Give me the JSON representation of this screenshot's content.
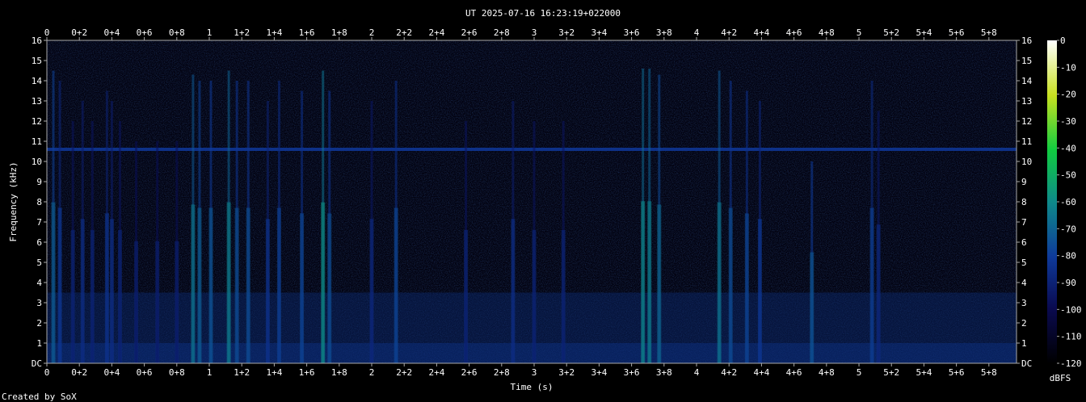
{
  "chart_data": {
    "type": "heatmap",
    "title": "UT 2025-07-16 16:23:19+022000",
    "xlabel": "Time (s)",
    "ylabel": "Frequency (kHz)",
    "xlim": [
      0,
      5.97
    ],
    "ylim": [
      0,
      16
    ],
    "x_ticks": [
      "0",
      "0+2",
      "0+4",
      "0+6",
      "0+8",
      "1",
      "1+2",
      "1+4",
      "1+6",
      "1+8",
      "2",
      "2+2",
      "2+4",
      "2+6",
      "2+8",
      "3",
      "3+2",
      "3+4",
      "3+6",
      "3+8",
      "4",
      "4+2",
      "4+4",
      "4+6",
      "4+8",
      "5",
      "5+2",
      "5+4",
      "5+6",
      "5+8"
    ],
    "x_tick_values": [
      0,
      0.2,
      0.4,
      0.6,
      0.8,
      1,
      1.2,
      1.4,
      1.6,
      1.8,
      2,
      2.2,
      2.4,
      2.6,
      2.8,
      3,
      3.2,
      3.4,
      3.6,
      3.8,
      4,
      4.2,
      4.4,
      4.6,
      4.8,
      5,
      5.2,
      5.4,
      5.6,
      5.8
    ],
    "y_ticks": [
      "DC",
      "1",
      "2",
      "3",
      "4",
      "5",
      "6",
      "7",
      "8",
      "9",
      "10",
      "11",
      "12",
      "13",
      "14",
      "15",
      "16"
    ],
    "y_tick_values": [
      0,
      1,
      2,
      3,
      4,
      5,
      6,
      7,
      8,
      9,
      10,
      11,
      12,
      13,
      14,
      15,
      16
    ],
    "colorbar": {
      "label": "dBFS",
      "ticks": [
        "0",
        "-10",
        "-20",
        "-30",
        "-40",
        "-50",
        "-60",
        "-70",
        "-80",
        "-90",
        "-100",
        "-110",
        "-120"
      ],
      "tick_values": [
        0,
        -10,
        -20,
        -30,
        -40,
        -50,
        -60,
        -70,
        -80,
        -90,
        -100,
        -110,
        -120
      ],
      "range": [
        -120,
        0
      ]
    },
    "horizontal_tone_khz": 10.6,
    "bursts": [
      {
        "t": 0.04,
        "fmax": 14.5,
        "level": -78
      },
      {
        "t": 0.08,
        "fmax": 14.0,
        "level": -88
      },
      {
        "t": 0.16,
        "fmax": 12.0,
        "level": -96
      },
      {
        "t": 0.22,
        "fmax": 13.0,
        "level": -92
      },
      {
        "t": 0.28,
        "fmax": 12.0,
        "level": -96
      },
      {
        "t": 0.37,
        "fmax": 13.5,
        "level": -90
      },
      {
        "t": 0.4,
        "fmax": 13.0,
        "level": -92
      },
      {
        "t": 0.45,
        "fmax": 12.0,
        "level": -96
      },
      {
        "t": 0.55,
        "fmax": 11.0,
        "level": -98
      },
      {
        "t": 0.68,
        "fmax": 11.0,
        "level": -98
      },
      {
        "t": 0.8,
        "fmax": 11.0,
        "level": -98
      },
      {
        "t": 0.9,
        "fmax": 14.3,
        "level": -72
      },
      {
        "t": 0.94,
        "fmax": 14.0,
        "level": -78
      },
      {
        "t": 1.01,
        "fmax": 14.0,
        "level": -80
      },
      {
        "t": 1.12,
        "fmax": 14.5,
        "level": -70
      },
      {
        "t": 1.17,
        "fmax": 14.0,
        "level": -82
      },
      {
        "t": 1.24,
        "fmax": 14.0,
        "level": -82
      },
      {
        "t": 1.36,
        "fmax": 13.0,
        "level": -90
      },
      {
        "t": 1.43,
        "fmax": 14.0,
        "level": -86
      },
      {
        "t": 1.57,
        "fmax": 13.5,
        "level": -84
      },
      {
        "t": 1.7,
        "fmax": 14.5,
        "level": -66
      },
      {
        "t": 1.74,
        "fmax": 13.5,
        "level": -82
      },
      {
        "t": 2.0,
        "fmax": 13.0,
        "level": -94
      },
      {
        "t": 2.15,
        "fmax": 14.0,
        "level": -84
      },
      {
        "t": 2.58,
        "fmax": 12.0,
        "level": -96
      },
      {
        "t": 2.87,
        "fmax": 13.0,
        "level": -92
      },
      {
        "t": 3.0,
        "fmax": 12.0,
        "level": -96
      },
      {
        "t": 3.18,
        "fmax": 12.0,
        "level": -96
      },
      {
        "t": 3.67,
        "fmax": 14.6,
        "level": -68
      },
      {
        "t": 3.71,
        "fmax": 14.6,
        "level": -70
      },
      {
        "t": 3.77,
        "fmax": 14.3,
        "level": -76
      },
      {
        "t": 4.14,
        "fmax": 14.5,
        "level": -72
      },
      {
        "t": 4.21,
        "fmax": 14.0,
        "level": -82
      },
      {
        "t": 4.31,
        "fmax": 13.5,
        "level": -84
      },
      {
        "t": 4.39,
        "fmax": 13.0,
        "level": -88
      },
      {
        "t": 4.71,
        "fmax": 10.0,
        "level": -80
      },
      {
        "t": 5.08,
        "fmax": 14.0,
        "level": -86
      },
      {
        "t": 5.12,
        "fmax": 12.5,
        "level": -94
      }
    ]
  },
  "footer": {
    "credit": "Created by SoX"
  }
}
